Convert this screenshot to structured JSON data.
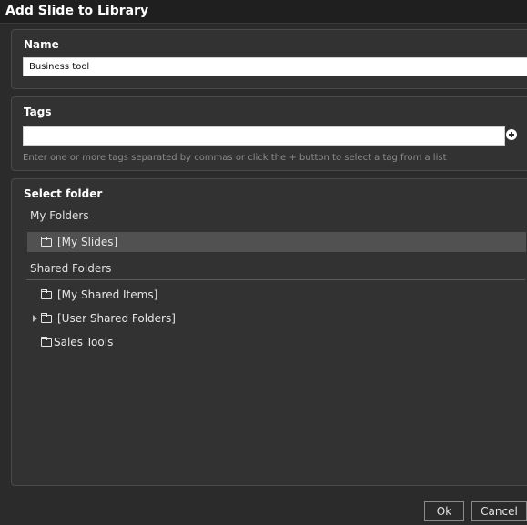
{
  "dialog": {
    "title": "Add Slide to Library"
  },
  "name_section": {
    "label": "Name",
    "value": "Business tool"
  },
  "tags_section": {
    "label": "Tags",
    "value": "",
    "add_icon": "plus-circle-icon",
    "help_text": "Enter one or more tags separated by commas or click the + button to select a tag from a list"
  },
  "folder_section": {
    "label": "Select folder",
    "my_folders": {
      "title": "My Folders",
      "items": [
        {
          "label": "[My Slides]",
          "selected": true
        }
      ]
    },
    "shared_folders": {
      "title": "Shared Folders",
      "items": [
        {
          "label": "[My Shared Items]",
          "expandable": false
        },
        {
          "label": "[User Shared Folders]",
          "expandable": true
        },
        {
          "label": "Sales Tools",
          "expandable": false
        }
      ]
    }
  },
  "footer": {
    "ok_label": "Ok",
    "cancel_label": "Cancel"
  },
  "colors": {
    "background": "#2b2b2b",
    "selected_row": "#515151"
  }
}
